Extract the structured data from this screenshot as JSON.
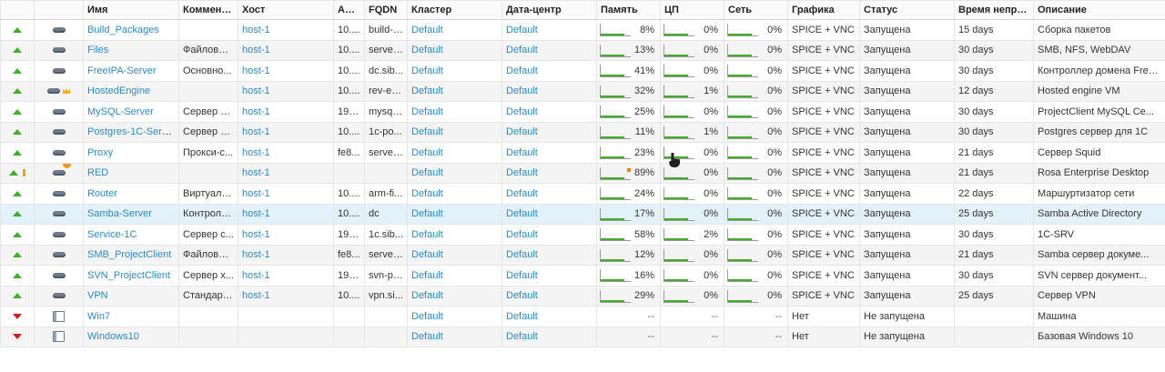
{
  "columns": [
    "",
    "",
    "Имя",
    "Комментар",
    "Хост",
    "Адрес",
    "FQDN",
    "Кластер",
    "Дата-центр",
    "Память",
    "ЦП",
    "Сеть",
    "Графика",
    "Статус",
    "Время непреры",
    "Описание"
  ],
  "vms": [
    {
      "state": "up",
      "type_icon": "server-vm-icon",
      "name": "Build_Packages",
      "comment": "",
      "host": "host-1",
      "address": "10....",
      "fqdn": "build-f...",
      "cluster": "Default",
      "datacenter": "Default",
      "memory": "8%",
      "cpu": "0%",
      "network": "0%",
      "graphics": "SPICE + VNC",
      "status": "Запущена",
      "uptime": "15 days",
      "description": "Сборка пакетов"
    },
    {
      "state": "up",
      "type_icon": "server-vm-icon",
      "name": "Files",
      "comment": "Файловы...",
      "host": "host-1",
      "address": "10....",
      "fqdn": "server...",
      "cluster": "Default",
      "datacenter": "Default",
      "memory": "13%",
      "cpu": "0%",
      "network": "0%",
      "graphics": "SPICE + VNC",
      "status": "Запущена",
      "uptime": "30 days",
      "description": "SMB, NFS, WebDAV"
    },
    {
      "state": "up",
      "type_icon": "server-vm-icon",
      "name": "FreeIPA-Server",
      "comment": "Основно...",
      "host": "host-1",
      "address": "10....",
      "fqdn": "dc.sib...",
      "cluster": "Default",
      "datacenter": "Default",
      "memory": "41%",
      "cpu": "0%",
      "network": "0%",
      "graphics": "SPICE + VNC",
      "status": "Запущена",
      "uptime": "30 days",
      "description": "Контроллер домена FreeIPA"
    },
    {
      "state": "up",
      "type_icon": "hosted-engine-icon",
      "name": "HostedEngine",
      "comment": "",
      "host": "host-1",
      "address": "10....",
      "fqdn": "rev-en...",
      "cluster": "Default",
      "datacenter": "Default",
      "memory": "32%",
      "cpu": "1%",
      "network": "0%",
      "graphics": "SPICE + VNC",
      "status": "Запущена",
      "uptime": "12 days",
      "description": "Hosted engine VM"
    },
    {
      "state": "up",
      "type_icon": "server-vm-icon",
      "name": "MySQL-Server",
      "comment": "Сервер M...",
      "host": "host-1",
      "address": "192....",
      "fqdn": "mysql....",
      "cluster": "Default",
      "datacenter": "Default",
      "memory": "25%",
      "cpu": "0%",
      "network": "0%",
      "graphics": "SPICE + VNC",
      "status": "Запущена",
      "uptime": "30 days",
      "description": "ProjectClient MySQL Ce..."
    },
    {
      "state": "up",
      "type_icon": "server-vm-icon",
      "name": "Postgres-1C-Server",
      "comment": "Сервер P...",
      "host": "host-1",
      "address": "10....",
      "fqdn": "1c-po...",
      "cluster": "Default",
      "datacenter": "Default",
      "memory": "11%",
      "cpu": "1%",
      "network": "0%",
      "graphics": "SPICE + VNC",
      "status": "Запущена",
      "uptime": "30 days",
      "description": "Postgres сервер для 1C"
    },
    {
      "state": "up",
      "type_icon": "server-vm-icon",
      "name": "Proxy",
      "comment": "Прокси-с...",
      "host": "host-1",
      "address": "fe8...",
      "fqdn": "server...",
      "cluster": "Default",
      "datacenter": "Default",
      "memory": "23%",
      "cpu": "0%",
      "network": "0%",
      "graphics": "SPICE + VNC",
      "status": "Запущена",
      "uptime": "21 days",
      "description": "Сервер Squid"
    },
    {
      "state": "up",
      "warn": true,
      "type_icon": "alert-vm-icon",
      "name": "RED",
      "comment": "",
      "host": "host-1",
      "address": "",
      "fqdn": "",
      "cluster": "Default",
      "datacenter": "Default",
      "memory": "89%",
      "cpu": "0%",
      "network": "0%",
      "graphics": "SPICE + VNC",
      "status": "Запущена",
      "uptime": "21 days",
      "description": "Rosa Enterprise Desktop",
      "hot": true
    },
    {
      "state": "up",
      "type_icon": "server-vm-icon",
      "name": "Router",
      "comment": "Виртуаль...",
      "host": "host-1",
      "address": "10....",
      "fqdn": "arm-fi...",
      "cluster": "Default",
      "datacenter": "Default",
      "memory": "24%",
      "cpu": "0%",
      "network": "0%",
      "graphics": "SPICE + VNC",
      "status": "Запущена",
      "uptime": "22 days",
      "description": "Маршуртизатор сети"
    },
    {
      "state": "up",
      "selected": true,
      "type_icon": "server-vm-icon",
      "name": "Samba-Server",
      "comment": "Контролл...",
      "host": "host-1",
      "address": "10....",
      "fqdn": "dc",
      "cluster": "Default",
      "datacenter": "Default",
      "memory": "17%",
      "cpu": "0%",
      "network": "0%",
      "graphics": "SPICE + VNC",
      "status": "Запущена",
      "uptime": "25 days",
      "description": "Samba Active Directory"
    },
    {
      "state": "up",
      "type_icon": "server-vm-icon",
      "name": "Service-1C",
      "comment": "Сервер с...",
      "host": "host-1",
      "address": "192....",
      "fqdn": "1c.sib...",
      "cluster": "Default",
      "datacenter": "Default",
      "memory": "58%",
      "cpu": "2%",
      "network": "0%",
      "graphics": "SPICE + VNC",
      "status": "Запущена",
      "uptime": "30 days",
      "description": "1C-SRV"
    },
    {
      "state": "up",
      "type_icon": "server-vm-icon",
      "name": "SMB_ProjectClient",
      "comment": "Файловы...",
      "host": "host-1",
      "address": "fe8...",
      "fqdn": "server...",
      "cluster": "Default",
      "datacenter": "Default",
      "memory": "12%",
      "cpu": "0%",
      "network": "0%",
      "graphics": "SPICE + VNC",
      "status": "Запущена",
      "uptime": "21 days",
      "description": "Samba сервер докуме..."
    },
    {
      "state": "up",
      "type_icon": "server-vm-icon",
      "name": "SVN_ProjectClient",
      "comment": "Сервер х...",
      "host": "host-1",
      "address": "192....",
      "fqdn": "svn-pc...",
      "cluster": "Default",
      "datacenter": "Default",
      "memory": "16%",
      "cpu": "0%",
      "network": "0%",
      "graphics": "SPICE + VNC",
      "status": "Запущена",
      "uptime": "30 days",
      "description": "SVN сервер документ..."
    },
    {
      "state": "up",
      "type_icon": "server-vm-icon",
      "name": "VPN",
      "comment": "Стандарт...",
      "host": "host-1",
      "address": "10....",
      "fqdn": "vpn.si...",
      "cluster": "Default",
      "datacenter": "Default",
      "memory": "29%",
      "cpu": "0%",
      "network": "0%",
      "graphics": "SPICE + VNC",
      "status": "Запущена",
      "uptime": "25 days",
      "description": "Сервер VPN"
    },
    {
      "state": "down",
      "type_icon": "desktop-vm-icon",
      "name": "Win7",
      "comment": "",
      "host": "",
      "address": "",
      "fqdn": "",
      "cluster": "Default",
      "datacenter": "Default",
      "memory": "--",
      "cpu": "--",
      "network": "--",
      "graphics": "Нет",
      "status": "Не запущена",
      "uptime": "",
      "description": "Машина"
    },
    {
      "state": "down",
      "type_icon": "desktop-vm-icon",
      "name": "Windows10",
      "comment": "",
      "host": "",
      "address": "",
      "fqdn": "",
      "cluster": "Default",
      "datacenter": "Default",
      "memory": "--",
      "cpu": "--",
      "network": "--",
      "graphics": "Нет",
      "status": "Не запущена",
      "uptime": "",
      "description": "Базовая Windows 10"
    }
  ]
}
